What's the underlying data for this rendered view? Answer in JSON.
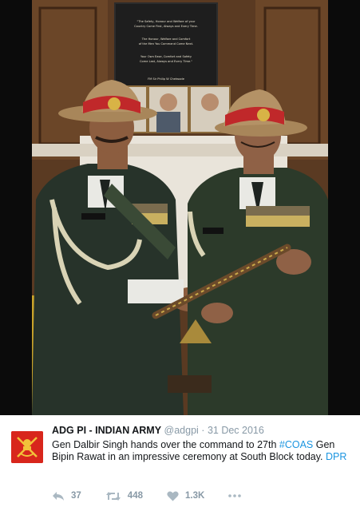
{
  "photo": {
    "plaque_lines": [
      "\"The Safety, Honour and Welfare of your",
      "Country Come First, Always and Every Time.",
      "The Honour, Welfare and Comfort",
      "of the Men You Command Come Next.",
      "Your Own Ease, Comfort and Safety",
      "Come Last, Always and Every Time.\"",
      "FM Sir Philip W Chetwode"
    ]
  },
  "tweet": {
    "author_name": "ADG PI - INDIAN ARMY",
    "handle": "@adgpi",
    "separator": "·",
    "date": "31 Dec 2016",
    "text_before": "Gen Dalbir Singh hands over the command to 27th ",
    "hashtag": "#COAS",
    "text_after": " Gen Bipin Rawat in an impressive ceremony at South Block today. ",
    "link": "DPR",
    "actions": {
      "replies": "37",
      "retweets": "448",
      "likes": "1.3K"
    }
  },
  "colors": {
    "link": "#1b95e0",
    "avatar_bg": "#d8261c",
    "uniform": "#2c3a2a",
    "cap_band": "#c0282a"
  }
}
